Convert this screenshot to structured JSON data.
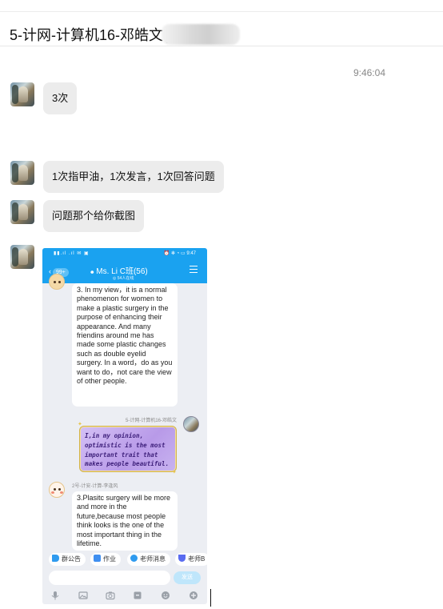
{
  "header": {
    "title": "5-计网-计算机16-邓皓文("
  },
  "timestamp": "9:46:04",
  "messages": [
    {
      "text": "3次"
    },
    {
      "text": "1次指甲油，1次发言，1次回答问题"
    },
    {
      "text": "问题那个给你截图"
    }
  ],
  "screenshot": {
    "status_left": "▮▮.ıl .ıl ✉ ▣",
    "status_right": "⏰ ✻ ◔ ▭ 9:47",
    "back_count": "99+",
    "group_name": "Ms. Li C班(56)",
    "online": "◎ 54人在线",
    "msg1_text": "3. In my view，it is a normal phenomenon for women to make a plastic surgery in the purpose of enhancing their appearance. And many friendins around me has made some plastic changes such as double eyelid surgery. In a word，do as you want to do，not care the view of other people.",
    "msg2_sender": "5-计网-计算机16-邓皓文",
    "msg2_text": "I,in my opinion, optimistic is the most important trait that makes people beautiful.",
    "msg3_sender": "2号-计安-计算-李逢风",
    "msg3_text": "3.Plasitc surgery will be more and more in the future,because most people think looks is the one of the most important thing in the lifetime.",
    "quick_actions": [
      {
        "label": "群公告",
        "icon": "megaphone-icon",
        "color": "#2f9bef"
      },
      {
        "label": "作业",
        "icon": "homework-icon",
        "color": "#3f8ff0"
      },
      {
        "label": "老师消息",
        "icon": "chat-bubble-icon",
        "color": "#2f9bef"
      },
      {
        "label": "老师B",
        "icon": "magnet-icon",
        "color": "#5a6cf0"
      }
    ],
    "send_label": "发送",
    "bottom_icons": [
      "mic-icon",
      "image-icon",
      "camera-icon",
      "archive-icon",
      "emoji-icon",
      "plus-icon"
    ]
  }
}
